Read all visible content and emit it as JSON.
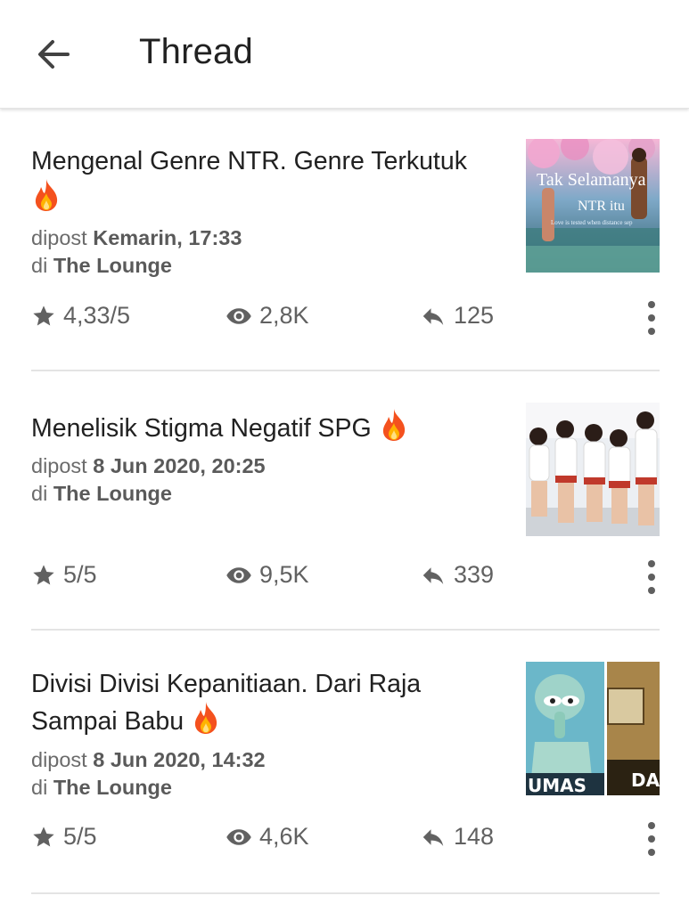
{
  "appbar": {
    "title": "Thread",
    "back_icon": "arrow-left-icon"
  },
  "threads": [
    {
      "title": "Mengenal Genre NTR. Genre Terkutuk",
      "hot_icon": "fire-icon",
      "posted_prefix": "dipost",
      "posted_time": "Kemarin, 17:33",
      "forum_prefix": "di",
      "forum": "The Lounge",
      "thumbnail_text": "Tak Selamanya NTR itu",
      "rating": "4,33/5",
      "views": "2,8K",
      "replies": "125"
    },
    {
      "title": "Menelisik Stigma Negatif SPG",
      "hot_icon": "fire-icon",
      "posted_prefix": "dipost",
      "posted_time": "8 Jun 2020, 20:25",
      "forum_prefix": "di",
      "forum": "The Lounge",
      "rating": "5/5",
      "views": "9,5K",
      "replies": "339"
    },
    {
      "title_line1": "Divisi Divisi Kepanitiaan. Dari Raja",
      "title_line2": "Sampai Babu",
      "hot_icon": "fire-icon",
      "posted_prefix": "dipost",
      "posted_time": "8 Jun 2020, 14:32",
      "forum_prefix": "di",
      "forum": "The Lounge",
      "thumbnail_text_left": "UMAS",
      "thumbnail_text_right": "DA",
      "rating": "5/5",
      "views": "4,6K",
      "replies": "148"
    }
  ],
  "colors": {
    "accent_fire": "#f4511e",
    "text": "#212121",
    "secondary": "#6b6b6b",
    "divider": "#e4e4e4"
  }
}
